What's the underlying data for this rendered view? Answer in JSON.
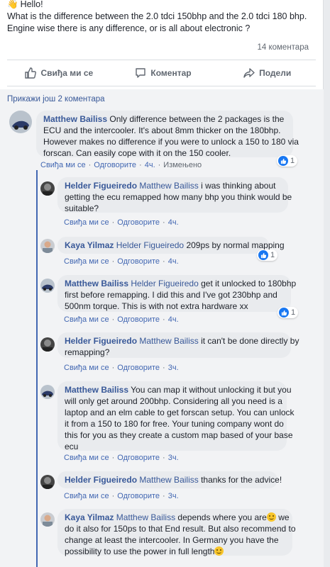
{
  "post": {
    "greeting": "Hello!",
    "text_line1": "What is the difference between the 2.0 tdci 150bhp and the 2.0 tdci 180 bhp.",
    "text_line2": "Engine wise there is any difference, or is all about electronic ?",
    "comment_count": "14 коментара"
  },
  "actions": {
    "like": "Свиђа ми се",
    "comment": "Коментар",
    "share": "Подели"
  },
  "comments_section": {
    "more_comments": "Прикажи још 2 коментара"
  },
  "labels": {
    "like": "Свиђа ми се",
    "reply": "Одговорите",
    "edited": "Измењено"
  },
  "comments": [
    {
      "author": "Matthew Bailiss",
      "lines": [
        " Only difference between the 2 packages is the",
        "ECU and the intercooler. It's about 8mm thicker on the 180bhp.",
        "However makes no difference if you were to unlock a 150 to 180 via",
        "forscan. Can easily cope with it on the 150 cooler."
      ],
      "time": "4ч.",
      "reactions": "1"
    },
    {
      "author": "Helder Figueiredo",
      "mention": "Matthew Bailiss",
      "lines": [
        " i was thinking about",
        "getting the ecu remapped how many bhp you think would be",
        "suitable?"
      ],
      "time": "4ч."
    },
    {
      "author": "Kaya Yilmaz",
      "mention": "Helder Figueiredo",
      "lines": [
        " 209ps by normal mapping"
      ],
      "time": "4ч.",
      "reactions": "1"
    },
    {
      "author": "Matthew Bailiss",
      "mention": "Helder Figueiredo",
      "lines": [
        " get it unlocked to 180bhp",
        "first before remapping. I did this and I've got 230bhp and",
        "500nm torque. This is with not extra hardware xx"
      ],
      "time": "4ч.",
      "reactions": "1"
    },
    {
      "author": "Helder Figueiredo",
      "mention": "Matthew Bailiss",
      "lines": [
        " it can't be done directly by",
        "remapping?"
      ],
      "time": "3ч."
    },
    {
      "author": "Matthew Bailiss",
      "lines": [
        " You can map it without unlocking it but you",
        "will only get around 200bhp. Considering all you need is a",
        "laptop and an elm cable to get forscan setup. You can unlock",
        "it from a 150 to 180 for free. Your tuning company wont do",
        "this for you as they create a custom map based of your base",
        "ecu"
      ],
      "time": "3ч."
    },
    {
      "author": "Helder Figueiredo",
      "mention": "Matthew Bailiss",
      "lines": [
        " thanks for the advice!"
      ],
      "time": "3ч."
    },
    {
      "author": "Kaya Yilmaz",
      "mention": "Matthew Bailiss",
      "lines": [
        " depends where you are",
        " we",
        "do it also for 150ps to that End result. But also recommend to",
        "change at least the intercooler. In Germany you have the",
        "possibility to use the power in full length"
      ],
      "time": ""
    }
  ],
  "colors": {
    "link": "#385898",
    "accent": "#4267b2",
    "like_blue": "#1877f2",
    "bubble": "#e9ebee"
  }
}
